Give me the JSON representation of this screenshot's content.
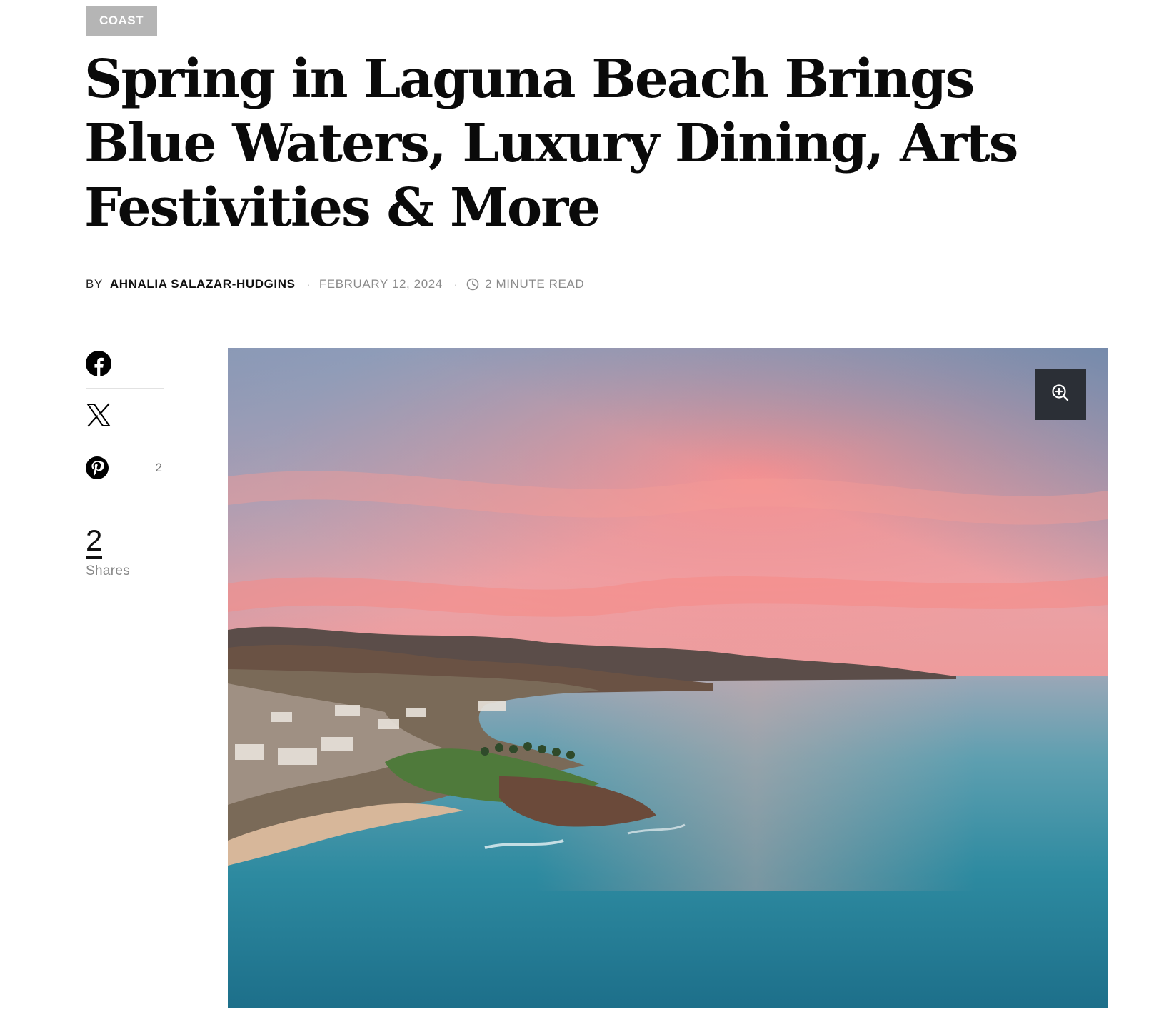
{
  "article": {
    "category": "COAST",
    "title": "Spring in Laguna Beach Brings Blue Waters, Luxury Dining, Arts Festivities & More",
    "byline_prefix": "BY",
    "author": "AHNALIA SALAZAR-HUDGINS",
    "separator": "·",
    "date": "FEBRUARY 12, 2024",
    "read_time": "2 MINUTE READ"
  },
  "share": {
    "items": [
      {
        "network": "Facebook",
        "icon": "facebook-icon",
        "count": ""
      },
      {
        "network": "X",
        "icon": "x-icon",
        "count": ""
      },
      {
        "network": "Pinterest",
        "icon": "pinterest-icon",
        "count": "2"
      }
    ],
    "total": "2",
    "total_label": "Shares"
  },
  "hero_image": {
    "description_icon": "zoom-in-icon",
    "colors": {
      "sky_pink": "#f59a95",
      "sky_blue": "#8fa4bd",
      "ocean": "#2f8ea3",
      "land": "#6b5a4a"
    }
  },
  "colors": {
    "badge_bg": "#b5b5b5",
    "text": "#111111",
    "muted": "#8a8a8a",
    "zoom_bg": "#2b2f36"
  }
}
